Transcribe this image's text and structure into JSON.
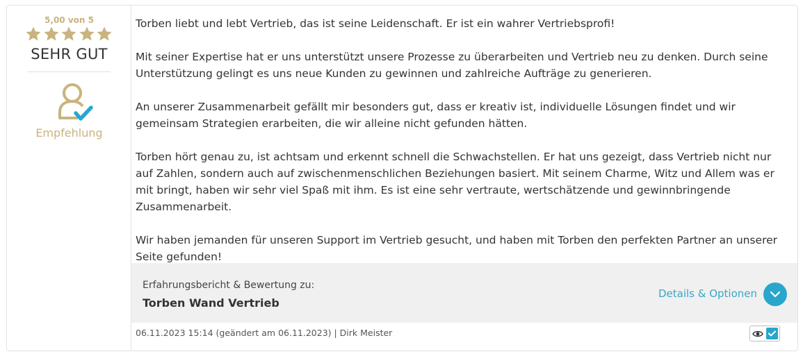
{
  "rating": {
    "score_text": "5,00 von 5",
    "stars": 5,
    "max_stars": 5,
    "label": "SEHR GUT",
    "recommendation": "Empfehlung"
  },
  "review": {
    "paragraphs": [
      "Torben liebt und lebt Vertrieb, das ist seine Leidenschaft. Er ist ein wahrer Vertriebsprofi!",
      "Mit seiner Expertise hat er uns unterstützt unsere Prozesse zu überarbeiten und Vertrieb neu zu denken. Durch seine Unterstützung gelingt es uns neue Kunden zu gewinnen und zahlreiche Aufträge zu generieren.",
      "An unserer Zusammenarbeit gefällt mir besonders gut, dass er kreativ ist, individuelle Lösungen findet und wir gemeinsam Strategien erarbeiten, die wir alleine nicht gefunden hätten.",
      "Torben hört genau zu, ist achtsam und erkennt schnell die Schwachstellen. Er hat uns gezeigt, dass Vertrieb nicht nur auf Zahlen, sondern auch auf zwischenmenschlichen Beziehungen basiert. Mit seinem Charme, Witz und Allem was er mit bringt, haben wir sehr viel Spaß mit ihm. Es ist eine sehr vertraute, wertschätzende und gewinnbringende Zusammenarbeit.",
      "Wir haben jemanden für unseren Support im Vertrieb gesucht, und haben mit Torben den perfekten Partner an unserer Seite gefunden!"
    ]
  },
  "footer": {
    "about_label": "Erfahrungsbericht & Bewertung zu:",
    "company": "Torben Wand Vertrieb",
    "details_label": "Details & Optionen"
  },
  "meta": {
    "text": "06.11.2023 15:14 (geändert am 06.11.2023) | Dirk Meister"
  },
  "icons": {
    "star": "star-icon",
    "recommend": "person-check-icon",
    "details": "chevron-down-icon",
    "view": "eye-icon",
    "verified": "checkmark-icon"
  },
  "colors": {
    "gold": "#c9b37e",
    "accent": "#29a6cc",
    "link": "#3aa6c6"
  }
}
